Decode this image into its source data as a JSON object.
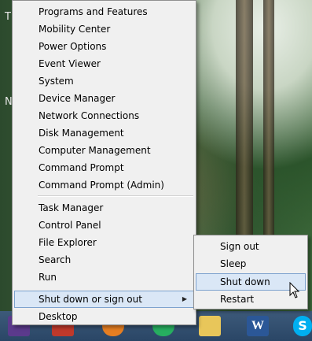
{
  "menu": {
    "items": [
      {
        "label": "Programs and Features"
      },
      {
        "label": "Mobility Center"
      },
      {
        "label": "Power Options"
      },
      {
        "label": "Event Viewer"
      },
      {
        "label": "System"
      },
      {
        "label": "Device Manager"
      },
      {
        "label": "Network Connections"
      },
      {
        "label": "Disk Management"
      },
      {
        "label": "Computer Management"
      },
      {
        "label": "Command Prompt"
      },
      {
        "label": "Command Prompt (Admin)"
      },
      {
        "label": "Task Manager"
      },
      {
        "label": "Control Panel"
      },
      {
        "label": "File Explorer"
      },
      {
        "label": "Search"
      },
      {
        "label": "Run"
      },
      {
        "label": "Shut down or sign out",
        "arrow": "▶"
      },
      {
        "label": "Desktop"
      }
    ]
  },
  "submenu": {
    "items": [
      {
        "label": "Sign out"
      },
      {
        "label": "Sleep"
      },
      {
        "label": "Shut down"
      },
      {
        "label": "Restart"
      }
    ]
  },
  "desktop": {
    "glyphs": [
      "T",
      "N"
    ]
  },
  "taskbar": {
    "icons": [
      {
        "name": "word-icon",
        "glyph": "W"
      },
      {
        "name": "skype-icon",
        "glyph": "S"
      }
    ]
  },
  "colors": {
    "menu_bg": "#f0f0f0",
    "highlight_bg": "#dae7f6",
    "highlight_border": "#7da2ce",
    "taskbar": "#2a4666"
  }
}
